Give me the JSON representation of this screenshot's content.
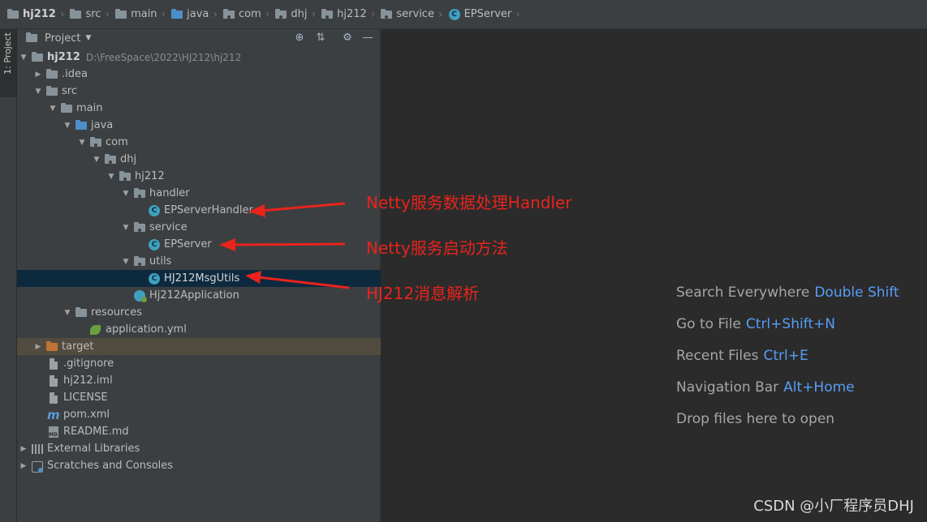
{
  "breadcrumb": [
    "hj212",
    "src",
    "main",
    "java",
    "com",
    "dhj",
    "hj212",
    "service",
    "EPServer"
  ],
  "toolstrip": {
    "project_tab": "1: Project"
  },
  "panel": {
    "title": "Project"
  },
  "tree": {
    "root": {
      "label": "hj212",
      "path": "D:\\FreeSpace\\2022\\HJ212\\hj212"
    },
    "idea": ".idea",
    "src": "src",
    "main": "main",
    "java": "java",
    "com": "com",
    "dhj": "dhj",
    "hj212": "hj212",
    "handler": "handler",
    "ep_server_handler": "EPServerHandler",
    "service": "service",
    "ep_server": "EPServer",
    "utils": "utils",
    "msg_utils": "HJ212MsgUtils",
    "application": "Hj212Application",
    "resources": "resources",
    "application_yml": "application.yml",
    "target": "target",
    "gitignore": ".gitignore",
    "iml": "hj212.iml",
    "license": "LICENSE",
    "pom": "pom.xml",
    "readme": "README.md",
    "external_libraries": "External Libraries",
    "scratches": "Scratches and Consoles"
  },
  "editor_hints": [
    {
      "label": "Search Everywhere",
      "key": "Double Shift"
    },
    {
      "label": "Go to File",
      "key": "Ctrl+Shift+N"
    },
    {
      "label": "Recent Files",
      "key": "Ctrl+E"
    },
    {
      "label": "Navigation Bar",
      "key": "Alt+Home"
    },
    {
      "label": "Drop files here to open",
      "key": ""
    }
  ],
  "annotations": {
    "handler": "Netty服务数据处理Handler",
    "server": "Netty服务启动方法",
    "utils": "HJ212消息解析"
  },
  "watermark": "CSDN @小厂程序员DHJ",
  "colors": {
    "background": "#2b2b2b",
    "panel": "#3c3f41",
    "selection": "#0d293e",
    "annotation": "#e8231c",
    "shortcut": "#589df6"
  }
}
